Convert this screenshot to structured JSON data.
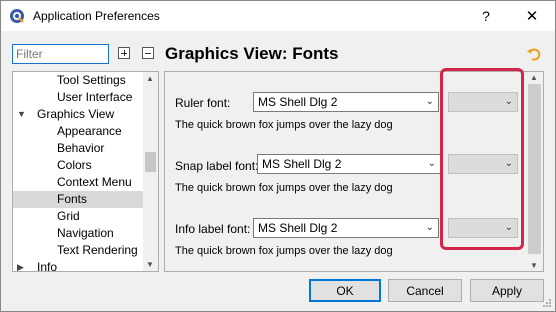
{
  "window": {
    "title": "Application Preferences",
    "help_label": "?",
    "close_label": "✕"
  },
  "sidebar": {
    "filter_placeholder": "Filter",
    "items": [
      {
        "label": "Tool Settings",
        "indent": 2
      },
      {
        "label": "User Interface",
        "indent": 2
      },
      {
        "label": "Graphics View",
        "indent": 1,
        "expanded": true
      },
      {
        "label": "Appearance",
        "indent": 2
      },
      {
        "label": "Behavior",
        "indent": 2
      },
      {
        "label": "Colors",
        "indent": 2
      },
      {
        "label": "Context Menu",
        "indent": 2
      },
      {
        "label": "Fonts",
        "indent": 2,
        "selected": true
      },
      {
        "label": "Grid",
        "indent": 2
      },
      {
        "label": "Navigation",
        "indent": 2
      },
      {
        "label": "Text Rendering",
        "indent": 2
      },
      {
        "label": "Info",
        "indent": 1,
        "expanded": false
      }
    ]
  },
  "main": {
    "title": "Graphics View: Fonts",
    "sections": [
      {
        "label": "Ruler font:",
        "font": "MS Shell Dlg 2",
        "preview": "The quick brown fox jumps over the lazy dog",
        "size": ""
      },
      {
        "label": "Snap label font:",
        "font": "MS Shell Dlg 2",
        "preview": "The quick brown fox jumps over the lazy dog",
        "size": ""
      },
      {
        "label": "Info label font:",
        "font": "MS Shell Dlg 2",
        "preview": "The quick brown fox jumps over the lazy dog",
        "size": ""
      }
    ]
  },
  "buttons": {
    "ok": "OK",
    "cancel": "Cancel",
    "apply": "Apply"
  },
  "colors": {
    "highlight": "#d5254a",
    "accent": "#0078d7"
  }
}
